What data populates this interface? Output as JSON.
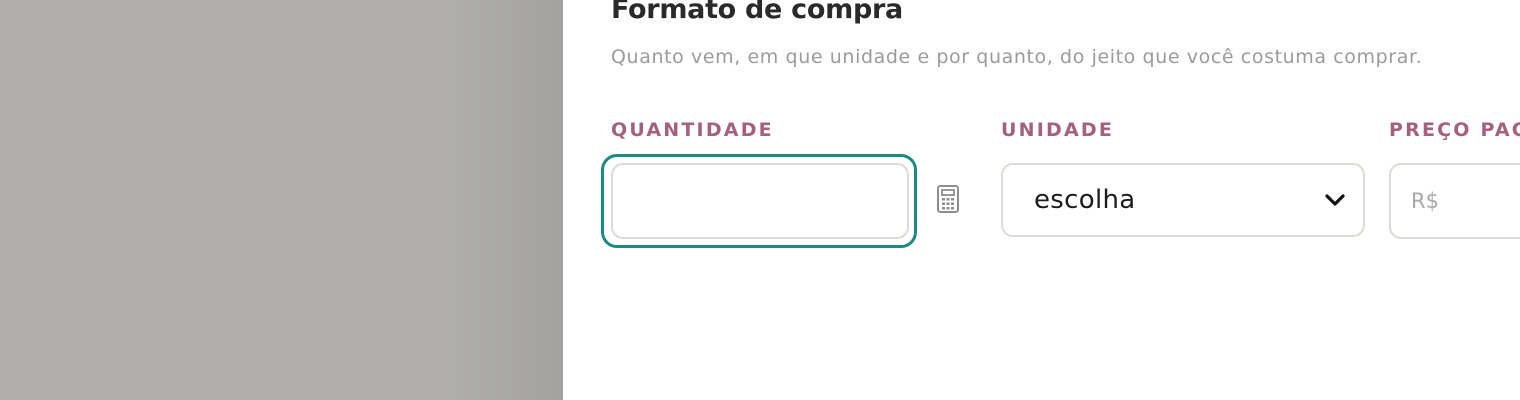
{
  "section": {
    "title": "Formato de compra",
    "subtitle": "Quanto vem, em que unidade e por quanto, do jeito que você costuma comprar."
  },
  "fields": {
    "quantity": {
      "label": "QUANTIDADE",
      "value": "",
      "placeholder": ""
    },
    "unit": {
      "label": "UNIDADE",
      "selected": "escolha"
    },
    "price": {
      "label": "PREÇO PAGO",
      "currency": "R$",
      "value": ""
    }
  },
  "icons": {
    "calculator": "calculator-icon",
    "chevron": "chevron-down-icon"
  },
  "colors": {
    "focus_ring": "#1a8a82",
    "label": "#a4607f",
    "backdrop": "#b0afad"
  }
}
